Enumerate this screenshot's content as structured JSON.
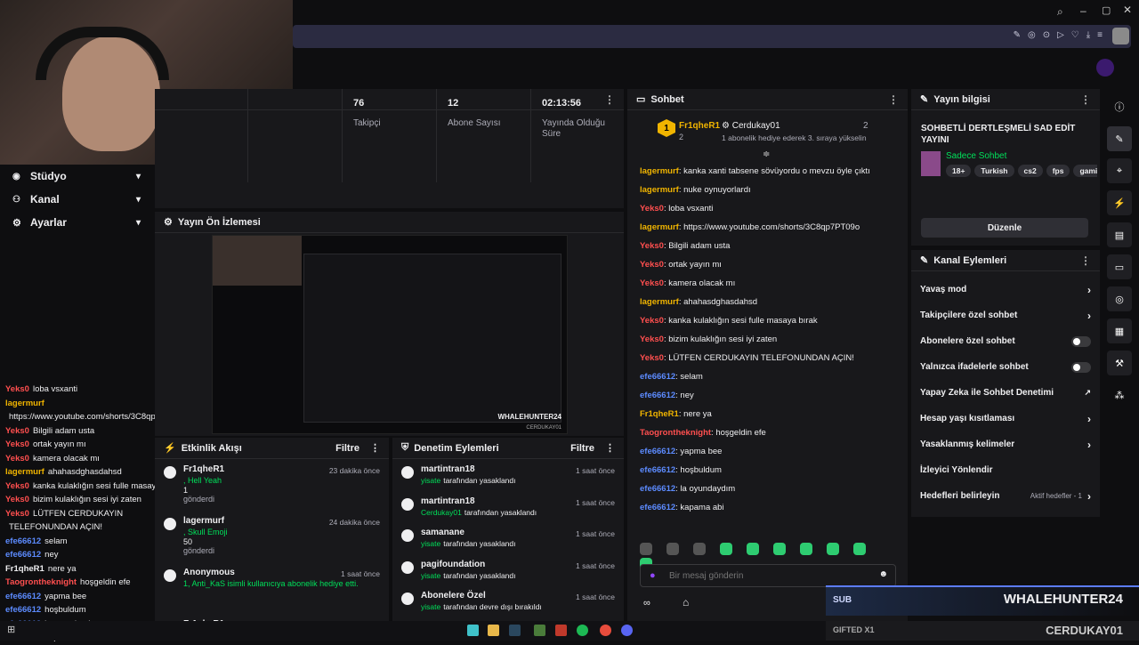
{
  "colors": {
    "accent": "#9147ff",
    "green": "#00e05a",
    "badge": "#f0b400"
  },
  "sidebar": {
    "items": [
      {
        "label": "Stüdyo",
        "icon": "camera-icon"
      },
      {
        "label": "Kanal",
        "icon": "users-icon"
      },
      {
        "label": "Ayarlar",
        "icon": "gear-icon"
      }
    ]
  },
  "stats": [
    {
      "value": "76",
      "label": "Takipçi"
    },
    {
      "value": "12",
      "label": "Abone Sayısı"
    },
    {
      "value": "02:13:56",
      "label": "Yayında Olduğu Süre"
    }
  ],
  "preview": {
    "title": "Yayın Ön İzlemesi",
    "overlay_name": "WHALEHUNTER24",
    "overlay_sub": "CERDUKAY01"
  },
  "activity": {
    "title": "Etkinlik Akışı",
    "filter": "Filtre",
    "events": [
      {
        "user": "Fr1qheR1",
        "detail": ", Hell Yeah",
        "amount": "1",
        "sent": "gönderdi",
        "time": "23 dakika önce"
      },
      {
        "user": "lagermurf",
        "detail": ", Skull Emoji",
        "amount": "50",
        "sent": "gönderdi",
        "time": "24 dakika önce"
      },
      {
        "user": "Anonymous",
        "detail": "1, Anti_KaS isimli kullanıcıya abonelik hediye etti.",
        "amount": "",
        "sent": "",
        "time": "1 saat önce"
      },
      {
        "user": "Fr1qheR1",
        "detail": "",
        "amount": "",
        "sent": "",
        "time": "1 saat önce"
      }
    ]
  },
  "moderation": {
    "title": "Denetim Eylemleri",
    "filter": "Filtre",
    "events": [
      {
        "user": "martintran18",
        "by": "yisate",
        "action": "tarafından yasaklandı",
        "time": "1 saat önce"
      },
      {
        "user": "martintran18",
        "by": "Cerdukay01",
        "action": "tarafından yasaklandı",
        "time": "1 saat önce"
      },
      {
        "user": "samanane",
        "by": "yisate",
        "action": "tarafından yasaklandı",
        "time": "1 saat önce"
      },
      {
        "user": "pagifoundation",
        "by": "yisate",
        "action": "tarafından yasaklandı",
        "time": "1 saat önce"
      },
      {
        "user": "Abonelere Özel",
        "by": "yisate",
        "action": "tarafından devre dışı bırakıldı",
        "time": "1 saat önce"
      }
    ]
  },
  "chat": {
    "title": "Sohbet",
    "placeholder": "Bir mesaj gönderin",
    "pinned_user1": "Fr1qheR1",
    "pinned_count1": "2",
    "pinned_user2": "Cerdukay01",
    "pinned_count2": "2",
    "pinned_rank": "1",
    "pinned_text": "1 abonelik hediye ederek 3. sıraya yükselin",
    "messages": [
      {
        "user": "lagermurf",
        "color": "#f0b400",
        "text": ": kanka xanti tabsene sövüyordu o mevzu öyle çıktı"
      },
      {
        "user": "lagermurf",
        "color": "#f0b400",
        "text": ": nuke oynuyorlardı"
      },
      {
        "user": "Yeks0",
        "color": "#ff4f4f",
        "text": ": loba vsxanti"
      },
      {
        "user": "lagermurf",
        "color": "#f0b400",
        "text": ": https://www.youtube.com/shorts/3C8qp7PT09o"
      },
      {
        "user": "Yeks0",
        "color": "#ff4f4f",
        "text": ": Bilgili adam usta"
      },
      {
        "user": "Yeks0",
        "color": "#ff4f4f",
        "text": ": ortak yayın mı"
      },
      {
        "user": "Yeks0",
        "color": "#ff4f4f",
        "text": ": kamera olacak mı"
      },
      {
        "user": "lagermurf",
        "color": "#f0b400",
        "text": ": ahahasdghasdahsd"
      },
      {
        "user": "Yeks0",
        "color": "#ff4f4f",
        "text": ": kanka kulaklığın sesi fulle masaya bırak"
      },
      {
        "user": "Yeks0",
        "color": "#ff4f4f",
        "text": ": bizim kulaklığın sesi iyi zaten"
      },
      {
        "user": "Yeks0",
        "color": "#ff4f4f",
        "text": ": LÜTFEN CERDUKAYIN TELEFONUNDAN AÇIN!"
      },
      {
        "user": "efe66612",
        "color": "#5c8bff",
        "text": ": selam"
      },
      {
        "user": "efe66612",
        "color": "#5c8bff",
        "text": ": ney"
      },
      {
        "user": "Fr1qheR1",
        "color": "#f0b400",
        "text": ": nere ya"
      },
      {
        "user": "Taogrontheknight",
        "color": "#ff4f4f",
        "text": ": hoşgeldin efe"
      },
      {
        "user": "efe66612",
        "color": "#5c8bff",
        "text": ": yapma bee"
      },
      {
        "user": "efe66612",
        "color": "#5c8bff",
        "text": ": hoşbuldum"
      },
      {
        "user": "efe66612",
        "color": "#5c8bff",
        "text": ": la oyundaydım"
      },
      {
        "user": "efe66612",
        "color": "#5c8bff",
        "text": ": kapama abi"
      }
    ]
  },
  "streaminfo": {
    "title": "Yayın bilgisi",
    "stream_title": "SOHBETLİ DERTLEŞMELİ SAD EDİT YAYINI",
    "category": "Sadece Sohbet",
    "tags": [
      "18+",
      "Turkish",
      "cs2",
      "fps",
      "gamin"
    ],
    "edit": "Düzenle"
  },
  "channel_actions": {
    "title": "Kanal Eylemleri",
    "items": [
      {
        "label": "Yavaş mod",
        "type": "arrow",
        "extra": ""
      },
      {
        "label": "Takipçilere özel sohbet",
        "type": "arrow",
        "extra": ""
      },
      {
        "label": "Abonelere özel sohbet",
        "type": "toggle",
        "extra": ""
      },
      {
        "label": "Yalnızca ifadelerle sohbet",
        "type": "toggle",
        "extra": ""
      },
      {
        "label": "Yapay Zeka ile Sohbet Denetimi",
        "type": "ext",
        "extra": ""
      },
      {
        "label": "Hesap yaşı kısıtlaması",
        "type": "arrow",
        "extra": ""
      },
      {
        "label": "Yasaklanmış kelimeler",
        "type": "arrow",
        "extra": ""
      },
      {
        "label": "İzleyici Yönlendir",
        "type": "none",
        "extra": ""
      },
      {
        "label": "Hedefleri belirleyin",
        "type": "arrow",
        "extra": "Aktif hedefler - 1"
      }
    ]
  },
  "overlay_chat": [
    {
      "user": "Yeks0",
      "color": "#ff4f4f",
      "text": "loba vsxanti"
    },
    {
      "user": "lagermurf",
      "color": "#f0b400",
      "text": ""
    },
    {
      "user": "",
      "color": "#efeff1",
      "text": "https://www.youtube.com/shorts/3C8qp7PT09o"
    },
    {
      "user": "Yeks0",
      "color": "#ff4f4f",
      "text": "Bilgili adam usta"
    },
    {
      "user": "Yeks0",
      "color": "#ff4f4f",
      "text": "ortak yayın mı"
    },
    {
      "user": "Yeks0",
      "color": "#ff4f4f",
      "text": "kamera olacak mı"
    },
    {
      "user": "lagermurf",
      "color": "#f0b400",
      "text": "ahahasdghasdahsd"
    },
    {
      "user": "Yeks0",
      "color": "#ff4f4f",
      "text": "kanka kulaklığın sesi fulle masaya bırak"
    },
    {
      "user": "Yeks0",
      "color": "#ff4f4f",
      "text": "bizim kulaklığın sesi iyi zaten"
    },
    {
      "user": "Yeks0",
      "color": "#ff4f4f",
      "text": "LÜTFEN CERDUKAYIN"
    },
    {
      "user": "",
      "color": "#efeff1",
      "text": "TELEFONUNDAN AÇIN!"
    },
    {
      "user": "efe66612",
      "color": "#5c8bff",
      "text": "selam"
    },
    {
      "user": "efe66612",
      "color": "#5c8bff",
      "text": "ney"
    },
    {
      "user": "Fr1qheR1",
      "color": "#efeff1",
      "text": "nere ya"
    },
    {
      "user": "Taogrontheknight",
      "color": "#ff4f4f",
      "text": "hoşgeldin efe"
    },
    {
      "user": "efe66612",
      "color": "#5c8bff",
      "text": "yapma bee"
    },
    {
      "user": "efe66612",
      "color": "#5c8bff",
      "text": "hoşbuldum"
    },
    {
      "user": "efe66612",
      "color": "#5c8bff",
      "text": "la oyundaydım"
    },
    {
      "user": "efe66612",
      "color": "#5c8bff",
      "text": "kapama abi"
    }
  ],
  "sub_banner": {
    "sub": "SUB",
    "name": "WHALEHUNTER24",
    "gifted": "GIFTED X1",
    "gifter": "CERDUKAY01"
  }
}
